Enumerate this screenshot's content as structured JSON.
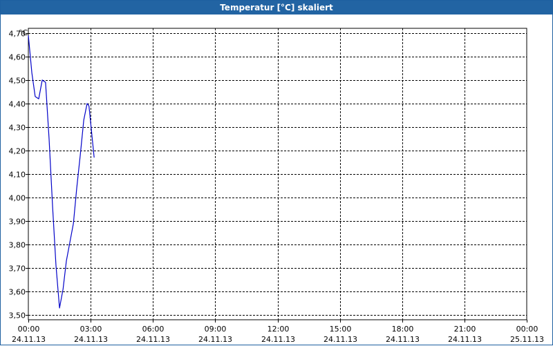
{
  "window": {
    "title": "Temperatur [°C] skaliert"
  },
  "chart_data": {
    "type": "line",
    "title": "Temperatur [°C] skaliert",
    "unit_label": "°C",
    "ylim": [
      3.48,
      4.72
    ],
    "y_ticks": [
      {
        "value": 4.7,
        "label": "4,70"
      },
      {
        "value": 4.6,
        "label": "4,60"
      },
      {
        "value": 4.5,
        "label": "4,50"
      },
      {
        "value": 4.4,
        "label": "4,40"
      },
      {
        "value": 4.3,
        "label": "4,30"
      },
      {
        "value": 4.2,
        "label": "4,20"
      },
      {
        "value": 4.1,
        "label": "4,10"
      },
      {
        "value": 4.0,
        "label": "4,00"
      },
      {
        "value": 3.9,
        "label": "3,90"
      },
      {
        "value": 3.8,
        "label": "3,80"
      },
      {
        "value": 3.7,
        "label": "3,70"
      },
      {
        "value": 3.6,
        "label": "3,60"
      },
      {
        "value": 3.5,
        "label": "3,50"
      }
    ],
    "xlim": [
      "24.11.13 00:00",
      "25.11.13 00:00"
    ],
    "x_ticks": [
      {
        "hours": 0,
        "time": "00:00",
        "date": "24.11.13"
      },
      {
        "hours": 3,
        "time": "03:00",
        "date": "24.11.13"
      },
      {
        "hours": 6,
        "time": "06:00",
        "date": "24.11.13"
      },
      {
        "hours": 9,
        "time": "09:00",
        "date": "24.11.13"
      },
      {
        "hours": 12,
        "time": "12:00",
        "date": "24.11.13"
      },
      {
        "hours": 15,
        "time": "15:00",
        "date": "24.11.13"
      },
      {
        "hours": 18,
        "time": "18:00",
        "date": "24.11.13"
      },
      {
        "hours": 21,
        "time": "21:00",
        "date": "24.11.13"
      },
      {
        "hours": 24,
        "time": "00:00",
        "date": "25.11.13"
      }
    ],
    "grid": true,
    "series": [
      {
        "color": "#0000c8",
        "points": [
          {
            "x": "24.11.13 00:00",
            "hours": 0.0,
            "y": 4.69
          },
          {
            "x": "24.11.13 00:10",
            "hours": 0.17,
            "y": 4.53
          },
          {
            "x": "24.11.13 00:20",
            "hours": 0.33,
            "y": 4.43
          },
          {
            "x": "24.11.13 00:30",
            "hours": 0.5,
            "y": 4.42
          },
          {
            "x": "24.11.13 00:40",
            "hours": 0.67,
            "y": 4.5
          },
          {
            "x": "24.11.13 00:50",
            "hours": 0.83,
            "y": 4.49
          },
          {
            "x": "24.11.13 01:00",
            "hours": 1.0,
            "y": 4.25
          },
          {
            "x": "24.11.13 01:10",
            "hours": 1.17,
            "y": 3.96
          },
          {
            "x": "24.11.13 01:20",
            "hours": 1.33,
            "y": 3.71
          },
          {
            "x": "24.11.13 01:30",
            "hours": 1.5,
            "y": 3.53
          },
          {
            "x": "24.11.13 01:40",
            "hours": 1.67,
            "y": 3.61
          },
          {
            "x": "24.11.13 01:50",
            "hours": 1.83,
            "y": 3.73
          },
          {
            "x": "24.11.13 02:00",
            "hours": 2.0,
            "y": 3.81
          },
          {
            "x": "24.11.13 02:10",
            "hours": 2.17,
            "y": 3.89
          },
          {
            "x": "24.11.13 02:20",
            "hours": 2.33,
            "y": 4.04
          },
          {
            "x": "24.11.13 02:30",
            "hours": 2.5,
            "y": 4.18
          },
          {
            "x": "24.11.13 02:40",
            "hours": 2.67,
            "y": 4.33
          },
          {
            "x": "24.11.13 02:50",
            "hours": 2.83,
            "y": 4.4
          },
          {
            "x": "24.11.13 02:55",
            "hours": 2.92,
            "y": 4.39
          },
          {
            "x": "24.11.13 03:10",
            "hours": 3.17,
            "y": 4.17
          }
        ]
      }
    ]
  }
}
